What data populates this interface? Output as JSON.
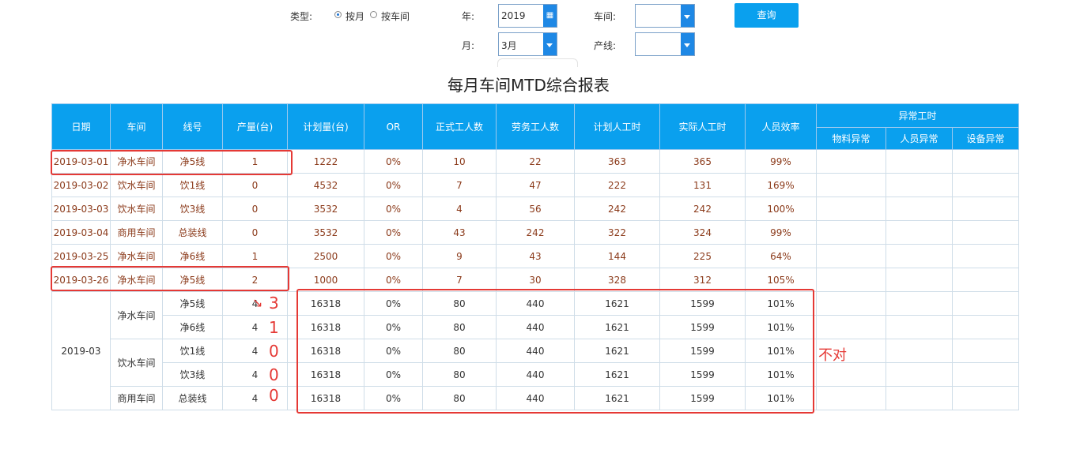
{
  "filters": {
    "type_label": "类型:",
    "type_options": [
      "按月",
      "按车间"
    ],
    "type_selected": "按月",
    "year_label": "年:",
    "year_value": "2019",
    "month_label": "月:",
    "month_value": "3月",
    "workshop_label": "车间:",
    "workshop_value": "",
    "line_label": "产线:",
    "line_value": "",
    "query_button": "查询"
  },
  "report": {
    "title": "每月车间MTD综合报表",
    "headers": {
      "date": "日期",
      "workshop": "车间",
      "line": "线号",
      "output": "产量(台)",
      "plan": "计划量(台)",
      "or": "OR",
      "formal_workers": "正式工人数",
      "labor_workers": "劳务工人数",
      "plan_hours": "计划人工时",
      "actual_hours": "实际人工时",
      "efficiency": "人员效率",
      "abnormal_group": "异常工时",
      "material_abnormal": "物料异常",
      "staff_abnormal": "人员异常",
      "equipment_abnormal": "设备异常"
    },
    "daily_rows": [
      {
        "date": "2019-03-01",
        "workshop": "净水车间",
        "line": "净5线",
        "output": "1",
        "plan": "1222",
        "or": "0%",
        "formal": "10",
        "labor": "22",
        "plan_hours": "363",
        "actual_hours": "365",
        "efficiency": "99%"
      },
      {
        "date": "2019-03-02",
        "workshop": "饮水车间",
        "line": "饮1线",
        "output": "0",
        "plan": "4532",
        "or": "0%",
        "formal": "7",
        "labor": "47",
        "plan_hours": "222",
        "actual_hours": "131",
        "efficiency": "169%"
      },
      {
        "date": "2019-03-03",
        "workshop": "饮水车间",
        "line": "饮3线",
        "output": "0",
        "plan": "3532",
        "or": "0%",
        "formal": "4",
        "labor": "56",
        "plan_hours": "242",
        "actual_hours": "242",
        "efficiency": "100%"
      },
      {
        "date": "2019-03-04",
        "workshop": "商用车间",
        "line": "总装线",
        "output": "0",
        "plan": "3532",
        "or": "0%",
        "formal": "43",
        "labor": "242",
        "plan_hours": "322",
        "actual_hours": "324",
        "efficiency": "99%"
      },
      {
        "date": "2019-03-25",
        "workshop": "净水车间",
        "line": "净6线",
        "output": "1",
        "plan": "2500",
        "or": "0%",
        "formal": "9",
        "labor": "43",
        "plan_hours": "144",
        "actual_hours": "225",
        "efficiency": "64%"
      },
      {
        "date": "2019-03-26",
        "workshop": "净水车间",
        "line": "净5线",
        "output": "2",
        "plan": "1000",
        "or": "0%",
        "formal": "7",
        "labor": "30",
        "plan_hours": "328",
        "actual_hours": "312",
        "efficiency": "105%"
      }
    ],
    "summary": {
      "month": "2019-03",
      "workshops": [
        "净水车间",
        "饮水车间",
        "商用车间"
      ],
      "rows": [
        {
          "line": "净5线",
          "output": "4",
          "plan": "16318",
          "or": "0%",
          "formal": "80",
          "labor": "440",
          "plan_hours": "1621",
          "actual_hours": "1599",
          "efficiency": "101%"
        },
        {
          "line": "净6线",
          "output": "4",
          "plan": "16318",
          "or": "0%",
          "formal": "80",
          "labor": "440",
          "plan_hours": "1621",
          "actual_hours": "1599",
          "efficiency": "101%"
        },
        {
          "line": "饮1线",
          "output": "4",
          "plan": "16318",
          "or": "0%",
          "formal": "80",
          "labor": "440",
          "plan_hours": "1621",
          "actual_hours": "1599",
          "efficiency": "101%"
        },
        {
          "line": "饮3线",
          "output": "4",
          "plan": "16318",
          "or": "0%",
          "formal": "80",
          "labor": "440",
          "plan_hours": "1621",
          "actual_hours": "1599",
          "efficiency": "101%"
        },
        {
          "line": "总装线",
          "output": "4",
          "plan": "16318",
          "or": "0%",
          "formal": "80",
          "labor": "440",
          "plan_hours": "1621",
          "actual_hours": "1599",
          "efficiency": "101%"
        }
      ]
    }
  },
  "annotations": {
    "corrections": [
      "3",
      "1",
      "0",
      "0",
      "0"
    ],
    "wrong_note": "不对",
    "color": "#e53935"
  },
  "colors": {
    "header_bg": "#0aa0ee",
    "value_text": "#8b3a1a",
    "button_blue": "#1e88e5"
  }
}
